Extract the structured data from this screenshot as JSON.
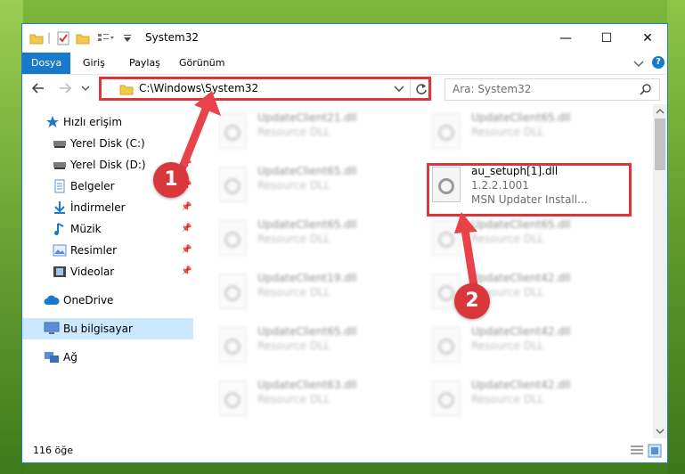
{
  "window": {
    "title": "System32",
    "minimize_glyph": "—",
    "maximize_glyph": "☐",
    "close_glyph": "✕"
  },
  "ribbon": {
    "tabs": [
      "Dosya",
      "Giriş",
      "Paylaş",
      "Görünüm"
    ],
    "help_glyph": "?"
  },
  "address": {
    "path": "C:\\Windows\\System32",
    "search_placeholder": "Ara: System32"
  },
  "nav": {
    "items": [
      {
        "label": "Hızlı erişim",
        "icon": "star-icon"
      },
      {
        "label": "Yerel Disk (C:)",
        "icon": "drive-icon"
      },
      {
        "label": "Yerel Disk (D:)",
        "icon": "drive-icon"
      },
      {
        "label": "Belgeler",
        "icon": "documents-icon"
      },
      {
        "label": "İndirmeler",
        "icon": "downloads-icon"
      },
      {
        "label": "Müzik",
        "icon": "music-icon"
      },
      {
        "label": "Resimler",
        "icon": "pictures-icon"
      },
      {
        "label": "Videolar",
        "icon": "videos-icon"
      },
      {
        "label": "OneDrive",
        "icon": "cloud-icon"
      },
      {
        "label": "Bu bilgisayar",
        "icon": "computer-icon"
      },
      {
        "label": "Ağ",
        "icon": "network-icon"
      }
    ]
  },
  "files": {
    "left": [
      {
        "name": "UpdateClient21.dll",
        "desc": "Resource DLL"
      },
      {
        "name": "UpdateClient65.dll",
        "desc": "Resource DLL"
      },
      {
        "name": "UpdateClient65.dll",
        "desc": "Resource DLL"
      },
      {
        "name": "UpdateClient19.dll",
        "desc": "Resource DLL"
      },
      {
        "name": "UpdateClient65.dll",
        "desc": "Resource DLL"
      },
      {
        "name": "UpdateClient63.dll",
        "desc": "Resource DLL"
      }
    ],
    "right": [
      {
        "name": "UpdateClient65.dll",
        "desc": "Resource DLL"
      },
      {
        "name": "UpdateClient65.dll",
        "desc": "Resource DLL"
      },
      {
        "name": "UpdateClient42.dll",
        "desc": "Resource DLL"
      },
      {
        "name": "UpdateClient42.dll",
        "desc": "Resource DLL"
      },
      {
        "name": "UpdateClient42.dll",
        "desc": "Resource DLL"
      }
    ],
    "highlighted": {
      "name": "au_setuph[1].dll",
      "version": "1.2.2.1001",
      "desc": "MSN Updater Install..."
    }
  },
  "status": {
    "count": "116 öğe"
  },
  "annotations": {
    "badge1": "1",
    "badge2": "2",
    "color": "#d9373b"
  }
}
